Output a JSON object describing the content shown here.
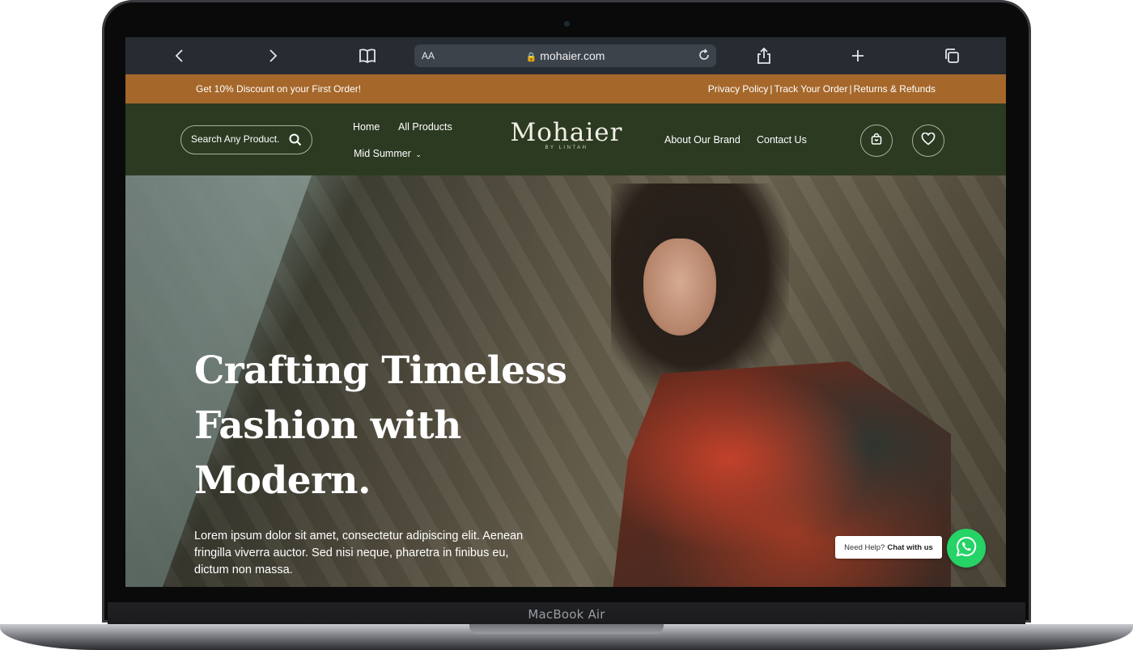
{
  "device": {
    "label": "MacBook Air"
  },
  "browser": {
    "text_size_label": "AA",
    "url": "mohaier.com"
  },
  "announcement": {
    "promo": "Get 10% Discount on your First Order!",
    "links": [
      "Privacy Policy",
      "Track Your Order",
      "Returns & Refunds"
    ],
    "separator": "|"
  },
  "header": {
    "search_placeholder": "Search Any Product..",
    "nav_left": [
      "Home",
      "All Products",
      "Mid Summer"
    ],
    "logo_name": "Mohaier",
    "logo_sub": "BY LINTAH",
    "nav_right": [
      "About Our Brand",
      "Contact Us"
    ]
  },
  "hero": {
    "title_lines": [
      "Crafting Timeless",
      "Fashion with",
      "Modern."
    ],
    "body": "Lorem ipsum dolor sit amet, consectetur adipiscing elit. Aenean fringilla viverra auctor. Sed nisi neque, pharetra in finibus eu, dictum non massa."
  },
  "chat": {
    "prompt": "Need Help?",
    "action": "Chat with us"
  },
  "colors": {
    "announcement_bg": "#a5672a",
    "header_bg": "#2c3a22",
    "toolbar_bg": "#272c33",
    "whatsapp_green": "#25d366"
  }
}
